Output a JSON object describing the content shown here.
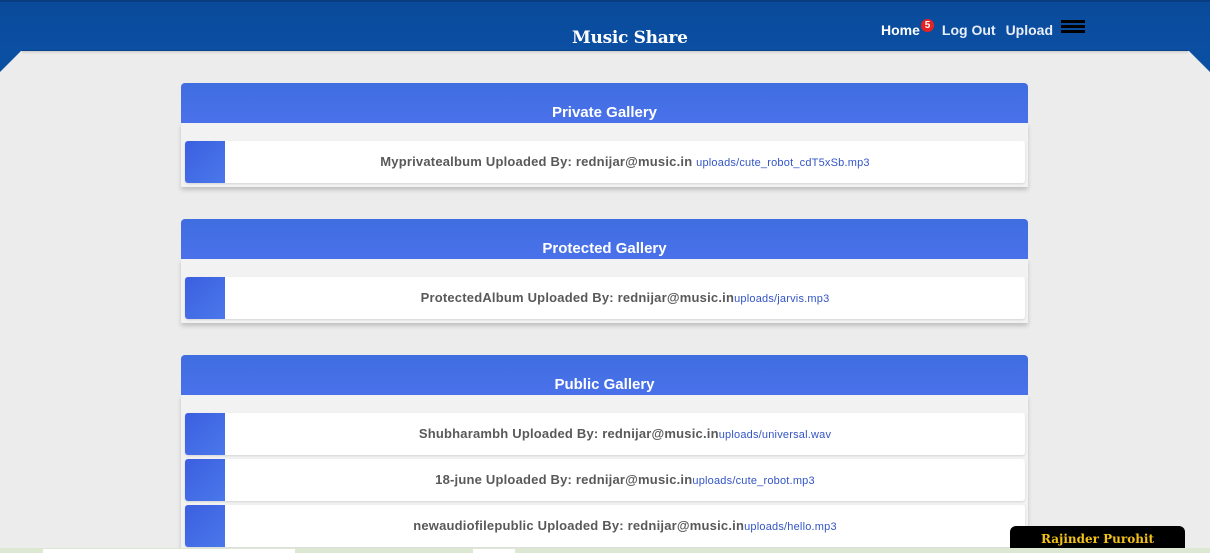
{
  "header": {
    "brand": "Music Share",
    "nav": {
      "home": "Home",
      "home_badge": "5",
      "logout": "Log Out",
      "upload": "Upload"
    },
    "menu_icon": "hamburger-menu-icon"
  },
  "galleries": [
    {
      "title": "Private Gallery",
      "items": [
        {
          "album": "Myprivatealbum Uploaded By: rednijar@music.in ",
          "file": "uploads/cute_robot_cdT5xSb.mp3"
        }
      ]
    },
    {
      "title": "Protected Gallery",
      "items": [
        {
          "album": "ProtectedAlbum Uploaded By: rednijar@music.in",
          "file": "uploads/jarvis.mp3"
        }
      ]
    },
    {
      "title": "Public Gallery",
      "items": [
        {
          "album": "Shubharambh Uploaded By: rednijar@music.in",
          "file": "uploads/universal.wav"
        },
        {
          "album": "18-june Uploaded By: rednijar@music.in",
          "file": "uploads/cute_robot.mp3"
        },
        {
          "album": "newaudiofilepublic Uploaded By: rednijar@music.in",
          "file": "uploads/hello.mp3"
        }
      ]
    }
  ],
  "footer": {
    "author": "Rajinder Purohit"
  },
  "colors": {
    "header": "#0b4fa3",
    "gallery_header": "#4a71ea",
    "badge": "#e52222",
    "link": "#3355c4",
    "footer_text": "#f2c21a"
  }
}
